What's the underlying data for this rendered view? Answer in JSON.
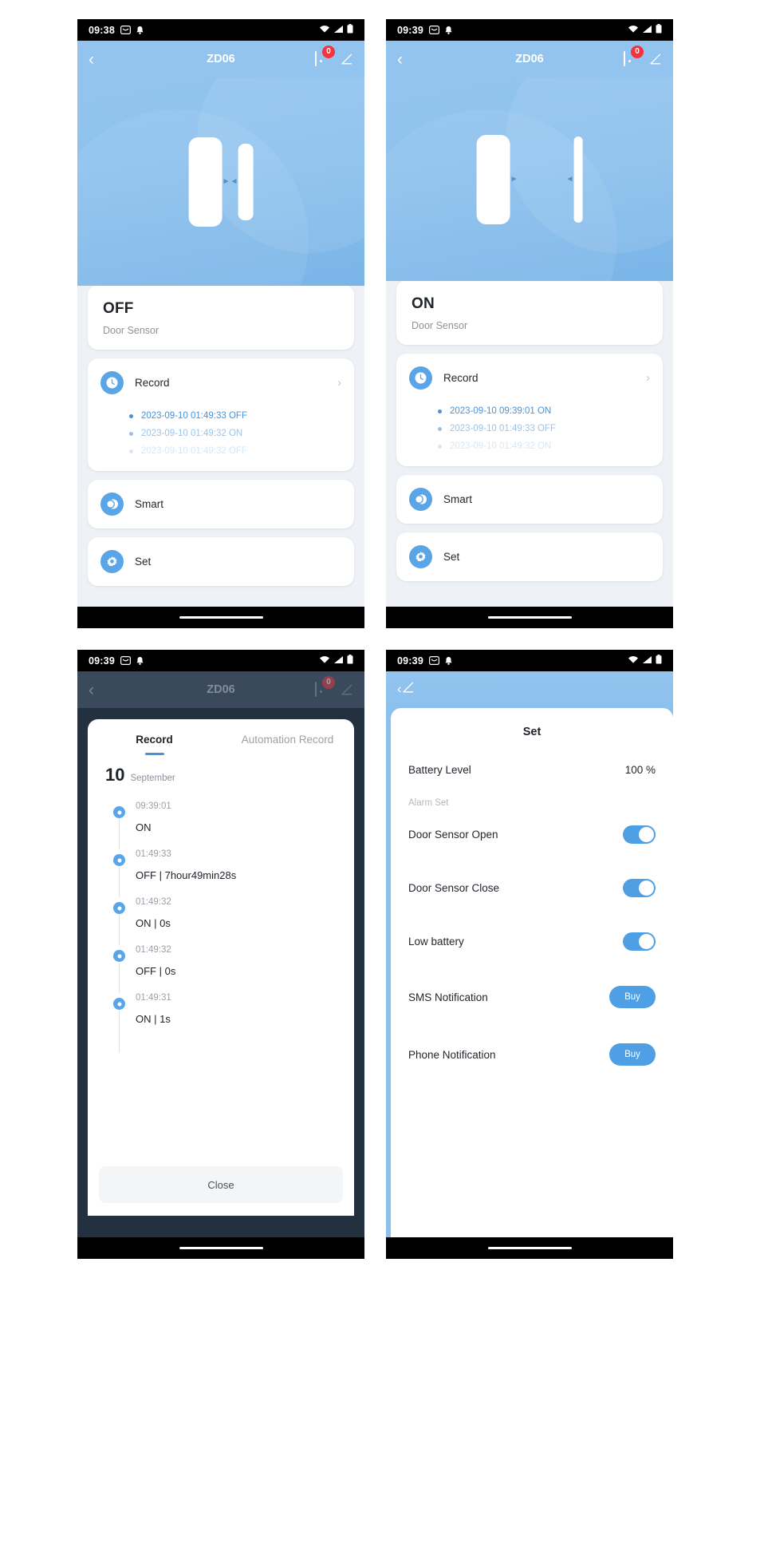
{
  "panels": [
    {
      "id": "panel-off",
      "statusbar": {
        "time": "09:38",
        "icons": [
          "mail-icon",
          "bell-icon"
        ],
        "right_icons": [
          "wifi-icon",
          "signal-icon",
          "battery-icon"
        ]
      },
      "appbar": {
        "title": "ZD06",
        "back_icon": "chevron-left-icon",
        "remote_icon": "remote-icon",
        "badge": "0",
        "edit_icon": "pencil-icon"
      },
      "state": {
        "value": "OFF",
        "subtitle": "Door Sensor"
      },
      "record": {
        "label": "Record",
        "icon": "clock-icon",
        "chevron": "chevron-right-icon",
        "entries": [
          {
            "text": "2023-09-10 01:49:33 OFF",
            "opacity": 1
          },
          {
            "text": "2023-09-10 01:49:32 ON",
            "opacity": 0.55
          },
          {
            "text": "2023-09-10 01:49:32 OFF",
            "opacity": 0.22
          }
        ]
      },
      "smart": {
        "label": "Smart",
        "icon": "toggle-icon"
      },
      "set": {
        "label": "Set",
        "icon": "gear-icon"
      },
      "sensor_open": false
    },
    {
      "id": "panel-on",
      "statusbar": {
        "time": "09:39",
        "icons": [
          "mail-icon",
          "bell-icon"
        ],
        "right_icons": [
          "wifi-icon",
          "signal-icon",
          "battery-icon"
        ]
      },
      "appbar": {
        "title": "ZD06",
        "back_icon": "chevron-left-icon",
        "remote_icon": "remote-icon",
        "badge": "0",
        "edit_icon": "pencil-icon"
      },
      "state": {
        "value": "ON",
        "subtitle": "Door Sensor"
      },
      "record": {
        "label": "Record",
        "icon": "clock-icon",
        "chevron": "chevron-right-icon",
        "entries": [
          {
            "text": "2023-09-10 09:39:01 ON",
            "opacity": 1
          },
          {
            "text": "2023-09-10 01:49:33 OFF",
            "opacity": 0.55
          },
          {
            "text": "2023-09-10 01:49:32 ON",
            "opacity": 0.22
          }
        ]
      },
      "smart": {
        "label": "Smart",
        "icon": "toggle-icon"
      },
      "set": {
        "label": "Set",
        "icon": "gear-icon"
      },
      "sensor_open": true
    }
  ],
  "record_modal": {
    "statusbar": {
      "time": "09:39"
    },
    "appbar": {
      "title": "ZD06",
      "badge": "0"
    },
    "tabs": [
      {
        "label": "Record",
        "active": true
      },
      {
        "label": "Automation Record",
        "active": false
      }
    ],
    "date": {
      "day": "10",
      "month": "September"
    },
    "timeline": [
      {
        "time": "09:39:01",
        "text": "ON"
      },
      {
        "time": "01:49:33",
        "text": "OFF  | 7hour49min28s"
      },
      {
        "time": "01:49:32",
        "text": "ON  | 0s"
      },
      {
        "time": "01:49:32",
        "text": "OFF  | 0s"
      },
      {
        "time": "01:49:31",
        "text": "ON  | 1s"
      }
    ],
    "close_label": "Close"
  },
  "set_page": {
    "statusbar": {
      "time": "09:39"
    },
    "appbar": {
      "back_icon": "chevron-left-icon",
      "edit_icon": "pencil-icon"
    },
    "title": "Set",
    "battery": {
      "label": "Battery Level",
      "value": "100 %"
    },
    "section_label": "Alarm Set",
    "rows": [
      {
        "label": "Door Sensor Open",
        "control": "toggle",
        "on": true
      },
      {
        "label": "Door Sensor Close",
        "control": "toggle",
        "on": true
      },
      {
        "label": "Low battery",
        "control": "toggle",
        "on": true
      },
      {
        "label": "SMS Notification",
        "control": "buy",
        "buy_label": "Buy"
      },
      {
        "label": "Phone Notification",
        "control": "buy",
        "buy_label": "Buy"
      }
    ]
  },
  "colors": {
    "accent": "#4f9fe4",
    "hero_blue": "#8cc0ee",
    "badge_red": "#f4333d",
    "record_blue": "#4892d6",
    "sheet_bg": "#eef2f6"
  }
}
